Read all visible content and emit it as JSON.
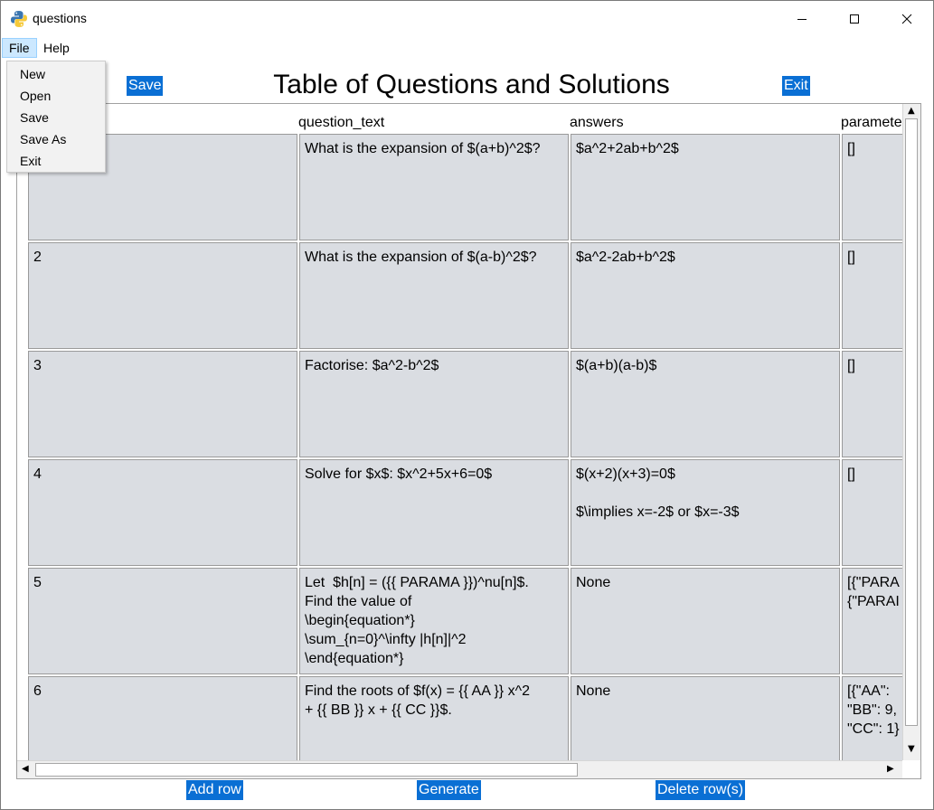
{
  "window": {
    "title": "questions"
  },
  "menubar": {
    "file_label": "File",
    "help_label": "Help"
  },
  "file_menu": {
    "items": [
      "New",
      "Open",
      "Save",
      "Save As",
      "Exit"
    ]
  },
  "toolbar": {
    "save_label": "Save",
    "exit_label": "Exit",
    "heading": "Table of Questions and Solutions"
  },
  "table": {
    "columns": [
      "question_text",
      "answers",
      "paramete"
    ],
    "rows": [
      {
        "id": "",
        "question_text": "What is the expansion of $(a+b)^2$?",
        "answers": "$a^2+2ab+b^2$",
        "parameters": "[]"
      },
      {
        "id": "2",
        "question_text": "What is the expansion of $(a-b)^2$?",
        "answers": "$a^2-2ab+b^2$",
        "parameters": "[]"
      },
      {
        "id": "3",
        "question_text": "Factorise: $a^2-b^2$",
        "answers": "$(a+b)(a-b)$",
        "parameters": "[]"
      },
      {
        "id": "4",
        "question_text": "Solve for $x$: $x^2+5x+6=0$",
        "answers": "$(x+2)(x+3)=0$\n\n$\\implies x=-2$ or $x=-3$",
        "parameters": "[]"
      },
      {
        "id": "5",
        "question_text": "Let  $h[n] = ({{ PARAMA }})^nu[n]$.\nFind the value of\n\\begin{equation*}\n\\sum_{n=0}^\\infty |h[n]|^2\n\\end{equation*}",
        "answers": "None",
        "parameters": "[{\"PARA\n{\"PARAI"
      },
      {
        "id": "6",
        "question_text": "Find the roots of $f(x) = {{ AA }} x^2\n+ {{ BB }} x + {{ CC }}$.",
        "answers": "None",
        "parameters": "[{\"AA\":\n\"BB\": 9,\n\"CC\": 1}"
      }
    ]
  },
  "bottom": {
    "add_row_label": "Add row",
    "generate_label": "Generate",
    "delete_label": "Delete row(s)"
  },
  "colors": {
    "button_bg": "#0a6fd4",
    "cell_bg": "#dadde2",
    "menu_highlight": "#cce8ff"
  }
}
